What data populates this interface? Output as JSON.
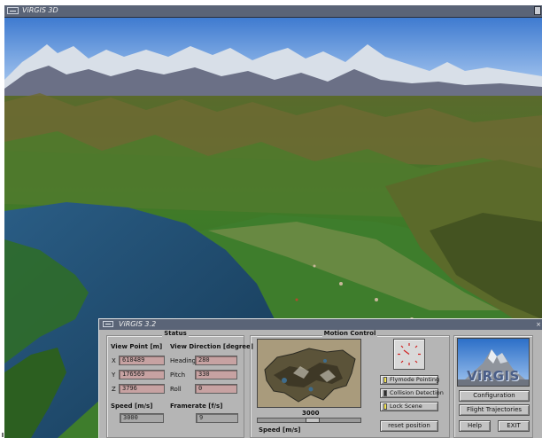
{
  "main_window": {
    "title": "ViRGIS 3D"
  },
  "control_panel": {
    "title": "ViRGIS 3.2",
    "status": {
      "heading": "Status",
      "view_point": {
        "heading": "View Point [m]",
        "x_label": "X",
        "x_value": "610489",
        "y_label": "Y",
        "y_value": "176569",
        "z_label": "Z",
        "z_value": "3796"
      },
      "view_direction": {
        "heading": "View Direction [degree]",
        "heading_label": "Heading",
        "heading_value": "280",
        "pitch_label": "Pitch",
        "pitch_value": "330",
        "roll_label": "Roll",
        "roll_value": "0"
      },
      "speed": {
        "label": "Speed [m/s]",
        "value": "3000"
      },
      "framerate": {
        "label": "Framerate [f/s]",
        "value": "9"
      }
    },
    "motion_control": {
      "heading": "Motion Control",
      "speed_value": "3000",
      "speed_label": "Speed [m/s]",
      "toggles": [
        {
          "label": "Flymode Pointing",
          "indicator_color": "#f2e24c"
        },
        {
          "label": "Collision Detection",
          "indicator_color": "#2d2d2d"
        },
        {
          "label": "Lock Scene",
          "indicator_color": "#f2e24c"
        }
      ],
      "reset_button": "reset position"
    },
    "side": {
      "logo_text": "ViRGIS",
      "configuration_button": "Configuration",
      "flight_trajectories_button": "Flight Trajectories",
      "help_button": "Help",
      "exit_button": "EXIT"
    }
  },
  "colors": {
    "titlebar": "#5a6477",
    "panel_bg": "#b5b5b5",
    "field_bg": "#c7a2a2",
    "sky": "#5b8fd6",
    "lake": "#1e4c6a",
    "terrain": "#3d7a2a"
  }
}
